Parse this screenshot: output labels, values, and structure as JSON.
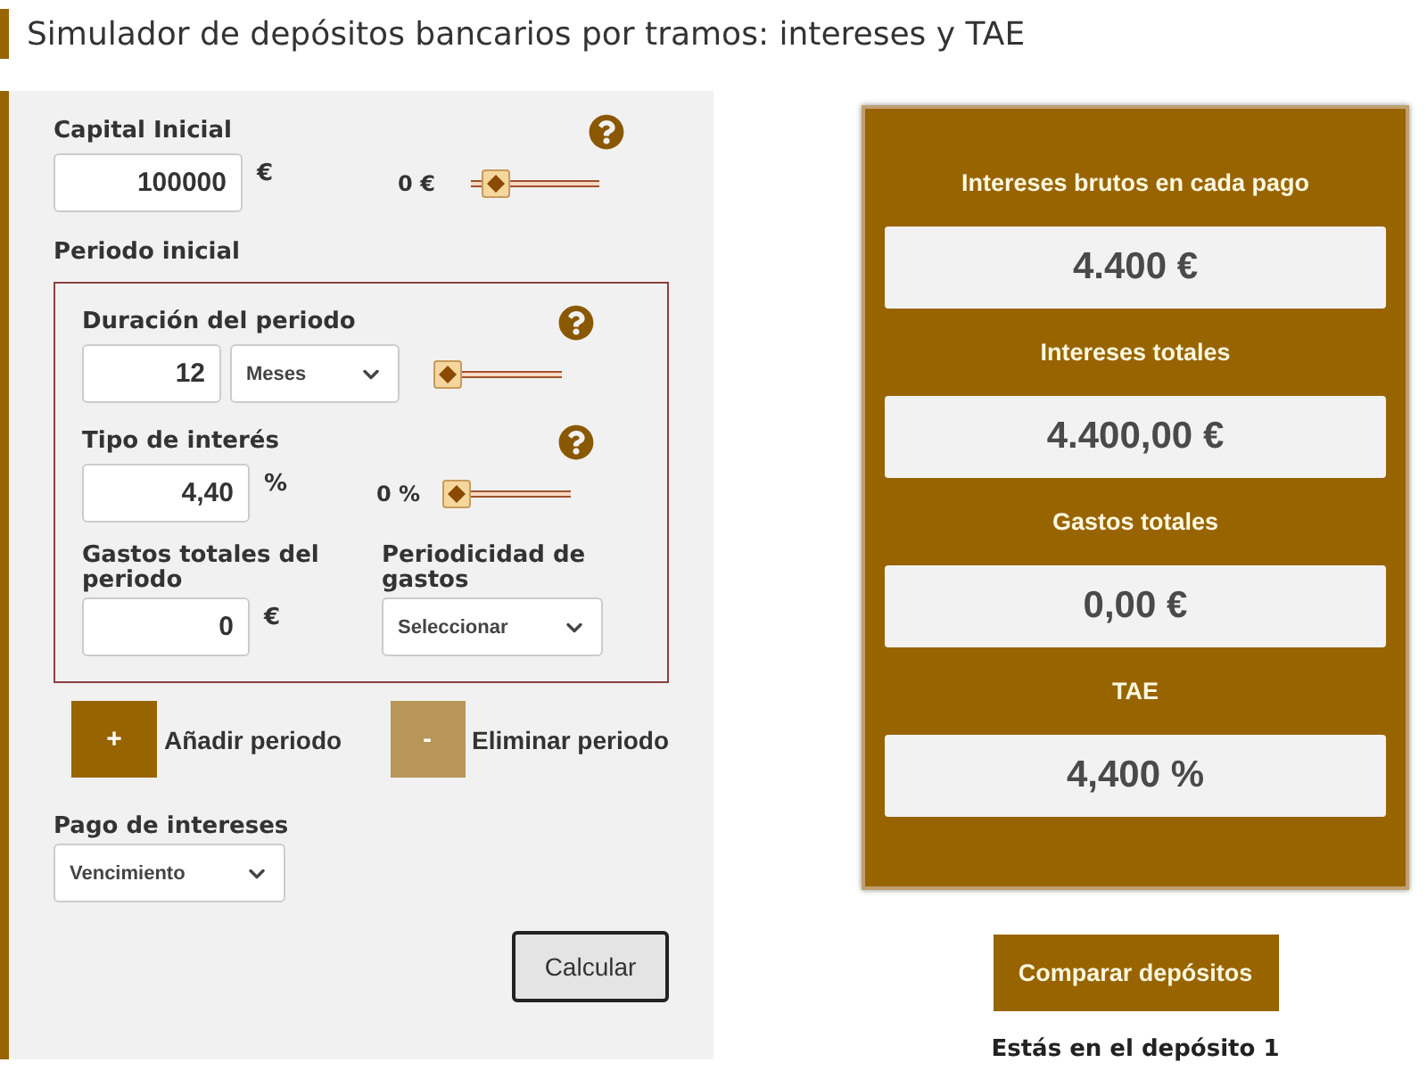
{
  "title": "Simulador de depósitos bancarios por tramos: intereses y TAE",
  "form": {
    "capital": {
      "label": "Capital Inicial",
      "value": "100000",
      "unit": "€",
      "slider_label": "0 €",
      "level": 0.1
    },
    "period_heading": "Periodo inicial",
    "duration": {
      "label": "Duración del periodo",
      "value": "12",
      "unit_select": "Meses",
      "level": 0
    },
    "rate": {
      "label": "Tipo de interés",
      "value": "4,40",
      "unit": "%",
      "slider_label": "0 %",
      "level": 0
    },
    "expenses": {
      "label": "Gastos totales del periodo",
      "value": "0",
      "unit": "€"
    },
    "expense_frequency": {
      "label": "Periodicidad de gastos",
      "value": "Seleccionar"
    },
    "period_buttons": [
      {
        "symbol": "+",
        "label": "Añadir periodo",
        "disabled": false
      },
      {
        "symbol": "-",
        "label": "Eliminar periodo",
        "disabled": true
      }
    ],
    "payment": {
      "label": "Pago de intereses",
      "value": "Vencimiento"
    },
    "calculate": "Calcular"
  },
  "results": [
    {
      "label": "Intereses brutos en cada pago",
      "value": "4.400 €"
    },
    {
      "label": "Intereses totales",
      "value": "4.400,00 €"
    },
    {
      "label": "Gastos totales",
      "value": "0,00 €"
    },
    {
      "label": "TAE",
      "value": "4,400 %"
    }
  ],
  "compare_button": "Comparar depósitos",
  "status": "Estás en el depósito 1"
}
